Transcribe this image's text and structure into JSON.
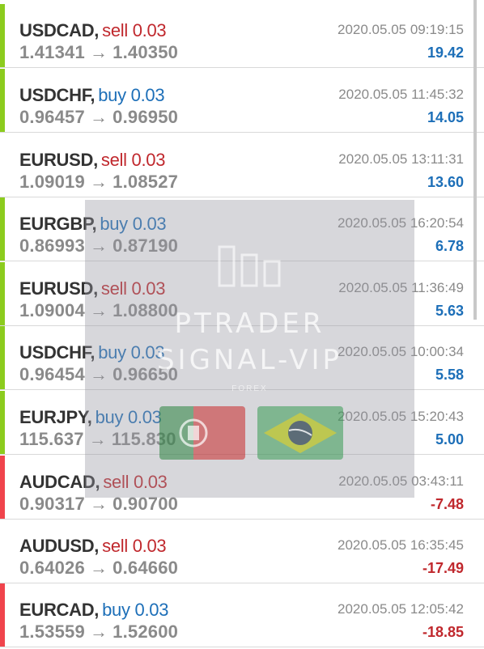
{
  "colors": {
    "bar_green": "#8ccc1e",
    "bar_red": "#f0444c",
    "sell": "#c0282d",
    "buy": "#1d6fb8",
    "profit_positive": "#1d6fb8",
    "profit_negative": "#c0282d"
  },
  "icons": {
    "arrow": "→"
  },
  "trades": [
    {
      "symbol": "USDCAD,",
      "action": "sell 0.03",
      "side": "sell",
      "open": "1.41341",
      "close": "1.40350",
      "time": "2020.05.05 09:19:15",
      "profit": "19.42",
      "bar": "green"
    },
    {
      "symbol": "USDCHF,",
      "action": "buy 0.03",
      "side": "buy",
      "open": "0.96457",
      "close": "0.96950",
      "time": "2020.05.05 11:45:32",
      "profit": "14.05",
      "bar": "green"
    },
    {
      "symbol": "EURUSD,",
      "action": "sell 0.03",
      "side": "sell",
      "open": "1.09019",
      "close": "1.08527",
      "time": "2020.05.05 13:11:31",
      "profit": "13.60",
      "bar": "none"
    },
    {
      "symbol": "EURGBP,",
      "action": "buy 0.03",
      "side": "buy",
      "open": "0.86993",
      "close": "0.87190",
      "time": "2020.05.05 16:20:54",
      "profit": "6.78",
      "bar": "green"
    },
    {
      "symbol": "EURUSD,",
      "action": "sell 0.03",
      "side": "sell",
      "open": "1.09004",
      "close": "1.08800",
      "time": "2020.05.05 11:36:49",
      "profit": "5.63",
      "bar": "green"
    },
    {
      "symbol": "USDCHF,",
      "action": "buy 0.03",
      "side": "buy",
      "open": "0.96454",
      "close": "0.96650",
      "time": "2020.05.05 10:00:34",
      "profit": "5.58",
      "bar": "green"
    },
    {
      "symbol": "EURJPY,",
      "action": "buy 0.03",
      "side": "buy",
      "open": "115.637",
      "close": "115.830",
      "time": "2020.05.05 15:20:43",
      "profit": "5.00",
      "bar": "green"
    },
    {
      "symbol": "AUDCAD,",
      "action": "sell 0.03",
      "side": "sell",
      "open": "0.90317",
      "close": "0.90700",
      "time": "2020.05.05 03:43:11",
      "profit": "-7.48",
      "bar": "red"
    },
    {
      "symbol": "AUDUSD,",
      "action": "sell 0.03",
      "side": "sell",
      "open": "0.64026",
      "close": "0.64660",
      "time": "2020.05.05 16:35:45",
      "profit": "-17.49",
      "bar": "none"
    },
    {
      "symbol": "EURCAD,",
      "action": "buy 0.03",
      "side": "buy",
      "open": "1.53559",
      "close": "1.52600",
      "time": "2020.05.05 12:05:42",
      "profit": "-18.85",
      "bar": "red"
    }
  ],
  "watermark": {
    "line1": "PTRADER",
    "line2": "SIGNAL-VIP",
    "line3": "FOREX"
  }
}
